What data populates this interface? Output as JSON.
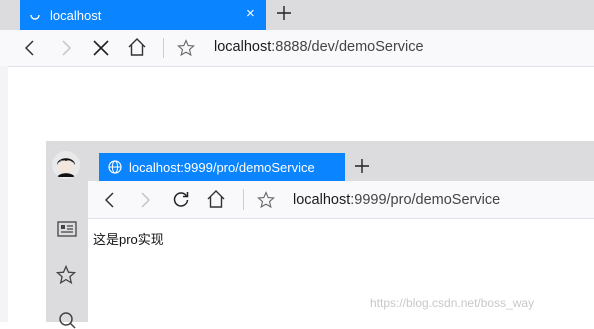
{
  "outer_window": {
    "tab": {
      "title": "localhost",
      "close_glyph": "×"
    },
    "new_tab_glyph": "+",
    "toolbar": {
      "url_host": "localhost",
      "url_rest": ":8888/dev/demoService",
      "icons": [
        "back-icon",
        "forward-icon",
        "stop-icon",
        "home-icon",
        "star-icon"
      ]
    }
  },
  "inner_window": {
    "tab": {
      "title": "localhost:9999/pro/demoService"
    },
    "new_tab_glyph": "+",
    "toolbar": {
      "url_host": "localhost",
      "url_rest": ":9999/pro/demoService",
      "icons": [
        "back-icon",
        "forward-icon",
        "reload-icon",
        "home-icon",
        "star-icon"
      ]
    },
    "sidebar_icons": [
      "avatar",
      "reader-icon",
      "favorites-icon",
      "search-icon"
    ],
    "page": {
      "text": "这是pro实现"
    }
  },
  "watermark": "https://blog.csdn.net/boss_way",
  "colors": {
    "tab_active": "#0a84ff",
    "tabbar_bg": "#dcdcdf",
    "toolbar_bg": "#f9f9fb"
  }
}
